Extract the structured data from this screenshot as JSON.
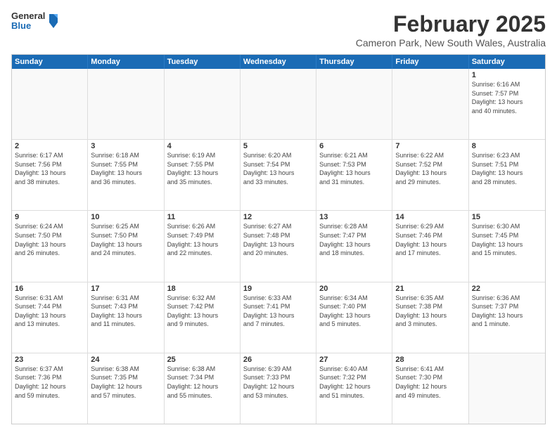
{
  "logo": {
    "general": "General",
    "blue": "Blue"
  },
  "header": {
    "month": "February 2025",
    "location": "Cameron Park, New South Wales, Australia"
  },
  "days_of_week": [
    "Sunday",
    "Monday",
    "Tuesday",
    "Wednesday",
    "Thursday",
    "Friday",
    "Saturday"
  ],
  "weeks": [
    [
      {
        "day": "",
        "info": ""
      },
      {
        "day": "",
        "info": ""
      },
      {
        "day": "",
        "info": ""
      },
      {
        "day": "",
        "info": ""
      },
      {
        "day": "",
        "info": ""
      },
      {
        "day": "",
        "info": ""
      },
      {
        "day": "1",
        "info": "Sunrise: 6:16 AM\nSunset: 7:57 PM\nDaylight: 13 hours\nand 40 minutes."
      }
    ],
    [
      {
        "day": "2",
        "info": "Sunrise: 6:17 AM\nSunset: 7:56 PM\nDaylight: 13 hours\nand 38 minutes."
      },
      {
        "day": "3",
        "info": "Sunrise: 6:18 AM\nSunset: 7:55 PM\nDaylight: 13 hours\nand 36 minutes."
      },
      {
        "day": "4",
        "info": "Sunrise: 6:19 AM\nSunset: 7:55 PM\nDaylight: 13 hours\nand 35 minutes."
      },
      {
        "day": "5",
        "info": "Sunrise: 6:20 AM\nSunset: 7:54 PM\nDaylight: 13 hours\nand 33 minutes."
      },
      {
        "day": "6",
        "info": "Sunrise: 6:21 AM\nSunset: 7:53 PM\nDaylight: 13 hours\nand 31 minutes."
      },
      {
        "day": "7",
        "info": "Sunrise: 6:22 AM\nSunset: 7:52 PM\nDaylight: 13 hours\nand 29 minutes."
      },
      {
        "day": "8",
        "info": "Sunrise: 6:23 AM\nSunset: 7:51 PM\nDaylight: 13 hours\nand 28 minutes."
      }
    ],
    [
      {
        "day": "9",
        "info": "Sunrise: 6:24 AM\nSunset: 7:50 PM\nDaylight: 13 hours\nand 26 minutes."
      },
      {
        "day": "10",
        "info": "Sunrise: 6:25 AM\nSunset: 7:50 PM\nDaylight: 13 hours\nand 24 minutes."
      },
      {
        "day": "11",
        "info": "Sunrise: 6:26 AM\nSunset: 7:49 PM\nDaylight: 13 hours\nand 22 minutes."
      },
      {
        "day": "12",
        "info": "Sunrise: 6:27 AM\nSunset: 7:48 PM\nDaylight: 13 hours\nand 20 minutes."
      },
      {
        "day": "13",
        "info": "Sunrise: 6:28 AM\nSunset: 7:47 PM\nDaylight: 13 hours\nand 18 minutes."
      },
      {
        "day": "14",
        "info": "Sunrise: 6:29 AM\nSunset: 7:46 PM\nDaylight: 13 hours\nand 17 minutes."
      },
      {
        "day": "15",
        "info": "Sunrise: 6:30 AM\nSunset: 7:45 PM\nDaylight: 13 hours\nand 15 minutes."
      }
    ],
    [
      {
        "day": "16",
        "info": "Sunrise: 6:31 AM\nSunset: 7:44 PM\nDaylight: 13 hours\nand 13 minutes."
      },
      {
        "day": "17",
        "info": "Sunrise: 6:31 AM\nSunset: 7:43 PM\nDaylight: 13 hours\nand 11 minutes."
      },
      {
        "day": "18",
        "info": "Sunrise: 6:32 AM\nSunset: 7:42 PM\nDaylight: 13 hours\nand 9 minutes."
      },
      {
        "day": "19",
        "info": "Sunrise: 6:33 AM\nSunset: 7:41 PM\nDaylight: 13 hours\nand 7 minutes."
      },
      {
        "day": "20",
        "info": "Sunrise: 6:34 AM\nSunset: 7:40 PM\nDaylight: 13 hours\nand 5 minutes."
      },
      {
        "day": "21",
        "info": "Sunrise: 6:35 AM\nSunset: 7:38 PM\nDaylight: 13 hours\nand 3 minutes."
      },
      {
        "day": "22",
        "info": "Sunrise: 6:36 AM\nSunset: 7:37 PM\nDaylight: 13 hours\nand 1 minute."
      }
    ],
    [
      {
        "day": "23",
        "info": "Sunrise: 6:37 AM\nSunset: 7:36 PM\nDaylight: 12 hours\nand 59 minutes."
      },
      {
        "day": "24",
        "info": "Sunrise: 6:38 AM\nSunset: 7:35 PM\nDaylight: 12 hours\nand 57 minutes."
      },
      {
        "day": "25",
        "info": "Sunrise: 6:38 AM\nSunset: 7:34 PM\nDaylight: 12 hours\nand 55 minutes."
      },
      {
        "day": "26",
        "info": "Sunrise: 6:39 AM\nSunset: 7:33 PM\nDaylight: 12 hours\nand 53 minutes."
      },
      {
        "day": "27",
        "info": "Sunrise: 6:40 AM\nSunset: 7:32 PM\nDaylight: 12 hours\nand 51 minutes."
      },
      {
        "day": "28",
        "info": "Sunrise: 6:41 AM\nSunset: 7:30 PM\nDaylight: 12 hours\nand 49 minutes."
      },
      {
        "day": "",
        "info": ""
      }
    ]
  ]
}
